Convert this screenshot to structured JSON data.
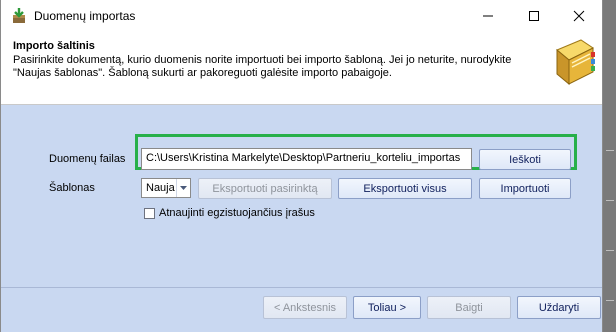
{
  "window": {
    "title": "Duomenų importas",
    "minimize_glyph": "—",
    "close_glyph": "✕"
  },
  "header": {
    "title": "Importo šaltinis",
    "description": "Pasirinkite dokumentą, kurio duomenis norite importuoti bei importo šabloną. Jei jo neturite, nurodykite \"Naujas šablonas\". Šabloną sukurti ar pakoreguoti galėsite importo pabaigoje.",
    "icon": "book-icon"
  },
  "form": {
    "file_label": "Duomenų failas",
    "file_path": "C:\\Users\\Kristina Markelyte\\Desktop\\Partneriu_korteliu_importas",
    "browse_label": "Ieškoti",
    "template_label": "Šablonas",
    "template_value": "Nauja",
    "export_selected_label": "Eksportuoti pasirinktą",
    "export_all_label": "Eksportuoti visus",
    "import_label": "Importuoti",
    "update_label": "Atnaujinti egzistuojančius įrašus",
    "update_checked": false
  },
  "footer": {
    "back_label": "< Ankstesnis",
    "next_label": "Toliau >",
    "finish_label": "Baigti",
    "close_label": "Uždaryti"
  },
  "colors": {
    "body_bg": "#c9d8f1",
    "highlight": "#27b04a",
    "button_text": "#0f1f5c"
  }
}
